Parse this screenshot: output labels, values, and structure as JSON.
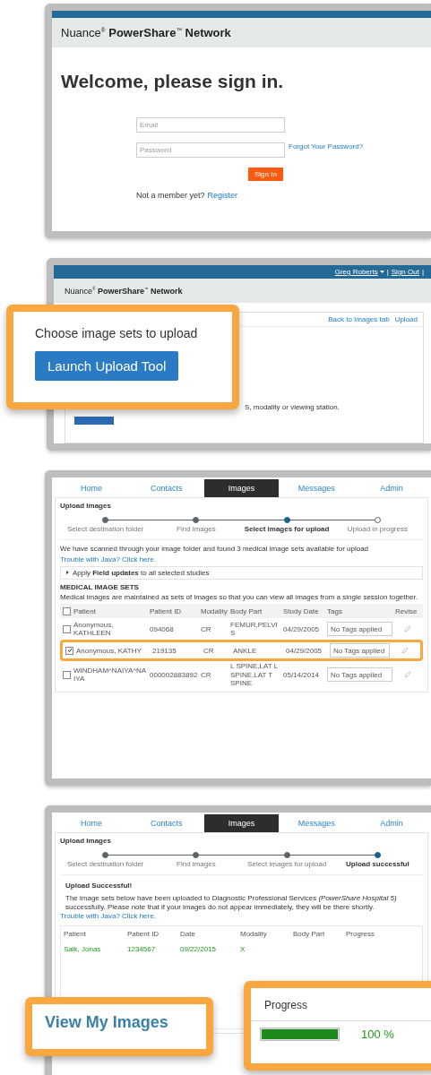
{
  "login": {
    "logo": "Nuance$^{®}$ **PowerShare**$^{™}$ **Network**",
    "heading": "Welcome, please sign in.",
    "email": {
      "placeholder": "Email"
    },
    "password": {
      "placeholder": "Password"
    },
    "forgot_link": "Forgot Your Password?",
    "sign_in_button": "Sign In",
    "member_prompt": "Not a member yet?",
    "register_link": "Register"
  },
  "upload_tool": {
    "user_menu": "Greg Roberts",
    "separator": "|",
    "sign_out": "Sign Out",
    "separator_end": "|",
    "logo": "Nuance$^{®}$ **PowerShare**$^{™}$ **Network**",
    "card_links": [
      "Back to Images tab",
      "Upload"
    ],
    "partial_text": "S, modality or viewing station.",
    "callout": {
      "title": "Choose image sets to upload",
      "button": "Launch Upload Tool"
    }
  },
  "select_images": {
    "tabs": [
      {
        "label": "Home",
        "selected": false
      },
      {
        "label": "Contacts",
        "selected": false
      },
      {
        "label": "Images",
        "selected": true
      },
      {
        "label": "Messages",
        "selected": false
      },
      {
        "label": "Admin",
        "selected": false
      }
    ],
    "title": "Upload Images",
    "steps": [
      {
        "label": "Select destination folder",
        "done": true,
        "current": false
      },
      {
        "label": "Find images",
        "done": true,
        "current": false
      },
      {
        "label": "Select images for upload",
        "done": false,
        "current": true
      },
      {
        "label": "Upload in progress",
        "done": false,
        "current": false
      }
    ],
    "scan_text": "We have scanned through your image folder and found 3 medical image sets available for upload",
    "java_link": "Trouble with Java? Click here.",
    "apply_text": "Apply **Field updates** to all selected studies",
    "sets_heading": "MEDICAL IMAGE SETS",
    "sets_text": "Medical images are maintained as sets of images so that you can view all images from a single session together.",
    "columns": [
      "Patient",
      "Patient ID",
      "Modality",
      "Body Part",
      "Study Date",
      "Tags",
      "Revise"
    ],
    "header_checked": false,
    "rows": [
      {
        "checked": false,
        "cells": [
          "Anonymous, KATHLEEN",
          "094068",
          "CR",
          "FEMUR,PELVIS",
          "04/29/2005"
        ],
        "tags": "No Tags applied",
        "highlighted": false
      },
      {
        "checked": true,
        "cells": [
          "Anonymous, KATHY",
          "219135",
          "CR",
          "ANKLE",
          "04/29/2005"
        ],
        "tags": "No Tags applied",
        "highlighted": true
      },
      {
        "checked": false,
        "cells": [
          "WINDHAM^NAIYA^NAIYA",
          "000002883892",
          "CR",
          "L SPINE,LAT L SPINE,LAT T SPINE",
          "05/14/2014"
        ],
        "tags": "No Tags applied",
        "highlighted": false
      }
    ]
  },
  "upload_success": {
    "tabs": [
      {
        "label": "Home",
        "selected": false
      },
      {
        "label": "Contacts",
        "selected": false
      },
      {
        "label": "Images",
        "selected": true
      },
      {
        "label": "Messages",
        "selected": false
      },
      {
        "label": "Admin",
        "selected": false
      }
    ],
    "title": "Upload Images",
    "steps": [
      {
        "label": "Select destination folder",
        "done": true,
        "current": false
      },
      {
        "label": "Find images",
        "done": true,
        "current": false
      },
      {
        "label": "Select images for upload",
        "done": true,
        "current": false
      },
      {
        "label": "Upload successful",
        "done": false,
        "current": true
      }
    ],
    "success_heading": "Upload Successful!",
    "success_text": "The image sets below have been uploaded to Diagnostic Professional Services *(PowerShare Hospital 5)* successfully. Please note that if your images do not appear immediately, they will be there shortly.",
    "java_link": "Trouble with Java? Click here.",
    "columns": [
      "Patient",
      "Patient ID",
      "Date",
      "Modality",
      "Body Part",
      "Progress"
    ],
    "row": [
      "Salk, Jonas",
      "1234567",
      "09/22/2015",
      "X"
    ],
    "view_callout": "View My Images",
    "progress_callout": {
      "header": "Progress",
      "level": 1,
      "reading": "100 %"
    }
  }
}
